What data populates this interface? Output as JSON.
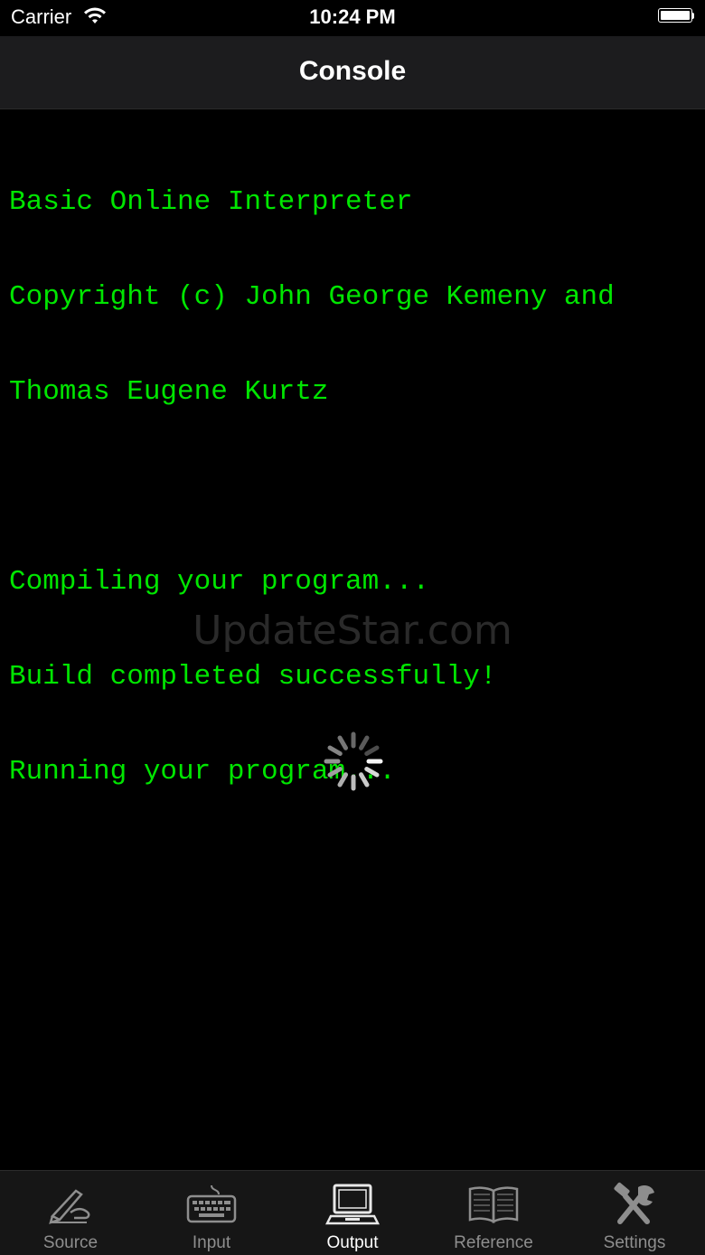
{
  "status_bar": {
    "carrier": "Carrier",
    "time": "10:24 PM"
  },
  "nav": {
    "title": "Console"
  },
  "console": {
    "lines": [
      "Basic Online Interpreter",
      "Copyright (c) John George Kemeny and",
      "Thomas Eugene Kurtz",
      "",
      "Compiling your program...",
      "Build completed successfully!",
      "Running your program..."
    ],
    "text_color": "#00e600"
  },
  "watermark": "UpdateStar.com",
  "tabs": [
    {
      "label": "Source",
      "icon": "pen-icon"
    },
    {
      "label": "Input",
      "icon": "keyboard-icon"
    },
    {
      "label": "Output",
      "icon": "computer-icon",
      "active": true
    },
    {
      "label": "Reference",
      "icon": "book-icon"
    },
    {
      "label": "Settings",
      "icon": "tools-icon"
    }
  ]
}
